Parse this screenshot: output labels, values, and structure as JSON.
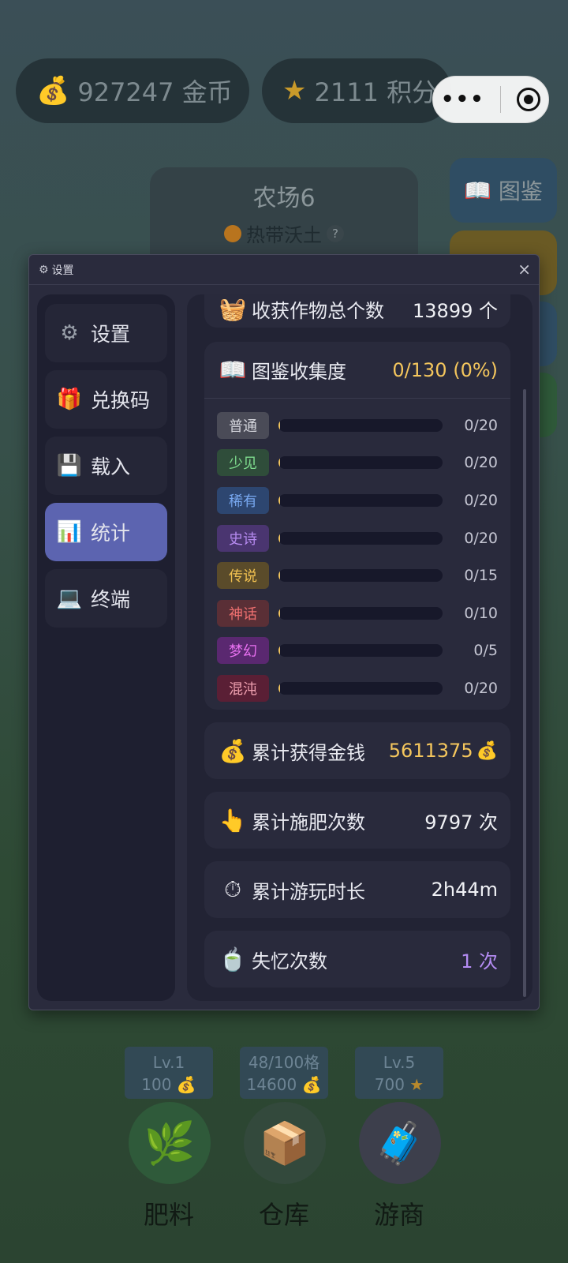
{
  "top_bar": {
    "coins": "927247 金币",
    "score": "2111 积分"
  },
  "farm": {
    "name": "农场6",
    "soil": "热带沃土"
  },
  "side_buttons": {
    "atlas": "图鉴"
  },
  "dialog": {
    "title": "设置",
    "close": "×"
  },
  "nav": {
    "items": [
      {
        "label": "设置",
        "icon": "gear-icon"
      },
      {
        "label": "兑换码",
        "icon": "gift-icon"
      },
      {
        "label": "载入",
        "icon": "floppy-disk-icon"
      },
      {
        "label": "统计",
        "icon": "bar-chart-icon"
      },
      {
        "label": "终端",
        "icon": "laptop-icon"
      }
    ],
    "active_index": 3
  },
  "stats": {
    "harvest": {
      "label": "收获作物总个数",
      "value": "13899 个"
    },
    "atlas": {
      "label": "图鉴收集度",
      "value": "0/130 (0%)",
      "rarities": [
        {
          "name": "普通",
          "count": "0/20",
          "bg": "#4a4b57",
          "fg": "#d6d7de",
          "progress": 0
        },
        {
          "name": "少见",
          "count": "0/20",
          "bg": "#2f4d3a",
          "fg": "#7fdc8e",
          "progress": 0
        },
        {
          "name": "稀有",
          "count": "0/20",
          "bg": "#2d4670",
          "fg": "#78a8f0",
          "progress": 0
        },
        {
          "name": "史诗",
          "count": "0/20",
          "bg": "#4a3570",
          "fg": "#b68af0",
          "progress": 0
        },
        {
          "name": "传说",
          "count": "0/15",
          "bg": "#5a4b2a",
          "fg": "#f0c050",
          "progress": 0
        },
        {
          "name": "神话",
          "count": "0/10",
          "bg": "#5a2f36",
          "fg": "#f07070",
          "progress": 0
        },
        {
          "name": "梦幻",
          "count": "0/5",
          "bg": "#5a2870",
          "fg": "#e870f0",
          "progress": 0
        },
        {
          "name": "混沌",
          "count": "0/20",
          "bg": "#5a1f35",
          "fg": "#f0a0b0",
          "progress": 0
        }
      ]
    },
    "money": {
      "label": "累计获得金钱",
      "value": "5611375"
    },
    "fertilize": {
      "label": "累计施肥次数",
      "value": "9797 次"
    },
    "playtime": {
      "label": "累计游玩时长",
      "value": "2h44m"
    },
    "amnesia": {
      "label": "失忆次数",
      "value": "1 次"
    }
  },
  "bottom": {
    "upgrades": [
      {
        "line1": "Lv.1",
        "line2": "100"
      },
      {
        "line1": "48/100格",
        "line2": "14600"
      },
      {
        "line1": "Lv.5",
        "line2": "700"
      }
    ],
    "tools": [
      {
        "label": "肥料",
        "icon": "branch-icon"
      },
      {
        "label": "仓库",
        "icon": "box-icon"
      },
      {
        "label": "游商",
        "icon": "suitcase-icon"
      }
    ]
  }
}
